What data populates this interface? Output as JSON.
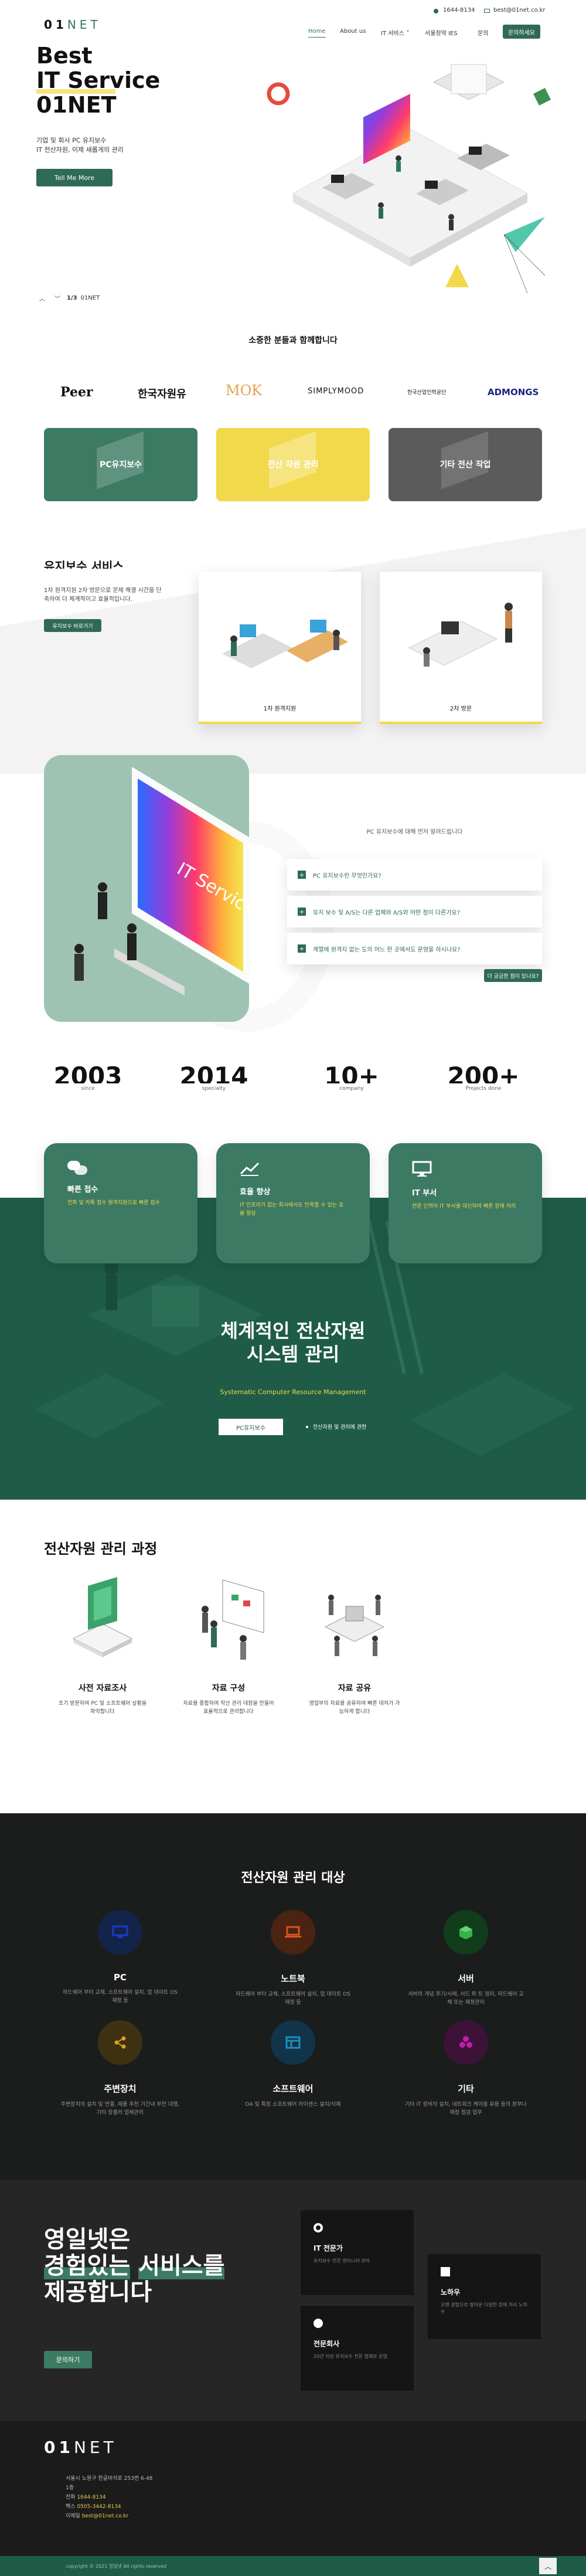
{
  "topbar": {
    "phone": "1644-8134",
    "email": "best@01net.co.kr"
  },
  "brand": {
    "logo_digits": "01",
    "logo_word": "NET"
  },
  "nav": {
    "items": [
      "Home",
      "About us",
      "IT 서비스",
      "서울청약 IES",
      "문의"
    ],
    "cta": "문의하세요"
  },
  "hero": {
    "title_line1": "Best",
    "title_line2": "IT Service",
    "title_line3": "01NET",
    "desc_line1": "기업 및 회사 PC 유지보수",
    "desc_line2": "IT 전산자원, 이제 새롭게의 관리",
    "button": "Tell Me More",
    "pager": "1/3",
    "pager_label": "01NET"
  },
  "partners": {
    "heading": "소중한 분들과 함께합니다",
    "logos": [
      "Peer",
      "한국자원유",
      "MOK",
      "SIMPLYMOOD",
      "한국산업인력공단",
      "ADMONGS"
    ]
  },
  "service_tiles": [
    {
      "label": "PC유지보수",
      "color": "#3c7a63"
    },
    {
      "label": "전산 자원 관리",
      "color": "#f2d84b"
    },
    {
      "label": "기타 전산 작업",
      "color": "#5b5b5b"
    }
  ],
  "intro": {
    "title": "유지보수 서비스",
    "desc_line1": "1차 원격지원 2차 방문으로 문제 해결 시간을 단",
    "desc_line2": "축하여 더 체계적이고 효율적입니다.",
    "button": "유지보수 바로가기",
    "card1_label": "1차 원격지원",
    "card2_label": "2차 방문"
  },
  "faq": {
    "subtitle": "PC 유지보수에 대해 먼저 알려드립니다",
    "items": [
      "PC 유지보수란 무엇인가요?",
      "유지 보수 및 A/S는 다른 업체와 A/S와 어떤 점이 다른가요?",
      "계열에 원격지 없는 도의 어느 한 곳에서도 운영을 하시나요?"
    ],
    "button": "더 궁금한 점이 있나요?"
  },
  "stats": [
    {
      "value": "2003",
      "label": "since"
    },
    {
      "value": "2014",
      "label": "specialty"
    },
    {
      "value": "10+",
      "label": "company"
    },
    {
      "value": "200+",
      "label": "Projects done"
    }
  ],
  "features": [
    {
      "title": "빠른 접수",
      "desc": "전화 및 카톡 접수 원격지원으로 빠른 접수",
      "icon": "chat-icon"
    },
    {
      "title": "효율 향상",
      "desc": "IT 인프라가 없는 회사에서도 만족할 수 있는 효율 향상",
      "icon": "chart-icon"
    },
    {
      "title": "IT 부서",
      "desc": "전문 인력이 IT 부서를 대신하여 빠른 장애 처리",
      "icon": "monitor-icon"
    }
  ],
  "banner": {
    "title_line1": "체계적인 전산자원",
    "title_line2": "시스템 관리",
    "subtitle": "Systematic Computer Resource Management",
    "button": "PC유지보수",
    "link": "전산자원 및 관리에 관한"
  },
  "process": {
    "heading": "전산자원 관리 과정",
    "steps": [
      {
        "title": "사전 자료조사",
        "desc_line1": "초기 방문하여 PC 및 소프트웨어 상황을",
        "desc_line2": "파악합니다"
      },
      {
        "title": "자료 구성",
        "desc_line1": "자료를 종합하여 작산 관리 대장을 만들어",
        "desc_line2": "효율적으로 관리합니다"
      },
      {
        "title": "자료 공유",
        "desc_line1": "영업부의 자료를 공유하여 빠른 대처가 가",
        "desc_line2": "능하게 합니다"
      }
    ]
  },
  "targets": {
    "heading": "전산자원 관리 대상",
    "items": [
      {
        "title": "PC",
        "desc_line1": "하드웨어 부터 교체, 소프트웨어 설치, 업 데이트 OS",
        "desc_line2": "재정 등",
        "color": "#1a3cc6",
        "bg": "#13244a",
        "icon": "monitor-icon"
      },
      {
        "title": "노트북",
        "desc_line1": "하드웨어 부터 교체, 소프트웨어 설치, 업 데이트 OS",
        "desc_line2": "재정 등",
        "color": "#d9531e",
        "bg": "#4a2312",
        "icon": "laptop-icon"
      },
      {
        "title": "서버",
        "desc_line1": "서버의 개념 주기/시에, 서드 파 트 정리, 하드웨어 교",
        "desc_line2": "체 또는 재정관리",
        "color": "#33b24a",
        "bg": "#123d1a",
        "icon": "server-icon"
      },
      {
        "title": "주변장치",
        "desc_line1": "주변장치의 설치 및 연결, 제품 추천 기간내 부전 대행,",
        "desc_line2": "기타 장볼러 업체관리",
        "color": "#d9a41e",
        "bg": "#3d3112",
        "icon": "share-icon"
      },
      {
        "title": "소프트웨어",
        "desc_line1": "OA 및 특정 소프트웨어 라이센스 설치/삭제",
        "desc_line2": "",
        "color": "#1b8fc0",
        "bg": "#12344a",
        "icon": "window-icon"
      },
      {
        "title": "기타",
        "desc_line1": "기타 IT 장비의 설치, 네트워크 케이블 유용 등의 본부나",
        "desc_line2": "재정 점검 업무",
        "color": "#c21ea8",
        "bg": "#3d1238",
        "icon": "apps-icon"
      }
    ]
  },
  "experts": {
    "title_line1": "영일넷은",
    "title_line2": "경험있는",
    "title_line3": "서비스를",
    "title_line4": "제공합니다",
    "button": "문의하기",
    "cards": [
      {
        "title": "IT 전문가",
        "desc": "유지보수 전문 엔지니어 관리"
      },
      {
        "title": "노하우",
        "desc": "오랜 경험으로 쌓아온 다양한 장애 처리 노하우"
      },
      {
        "title": "전문회사",
        "desc": "20년 이상 유지보수 전문 업체로 운영"
      }
    ]
  },
  "footer": {
    "address_line1": "서울시 노원구 한글비석로 253번 6-48",
    "address_line2": "1층",
    "phone_label": "전화",
    "phone": "1644-8134",
    "fax_label": "팩스",
    "fax": "0505-3442-8134",
    "email_label": "이메일",
    "email": "best@01net.co.kr",
    "copyright": "copyright © 2021 영일넷 AII rights reserved"
  }
}
